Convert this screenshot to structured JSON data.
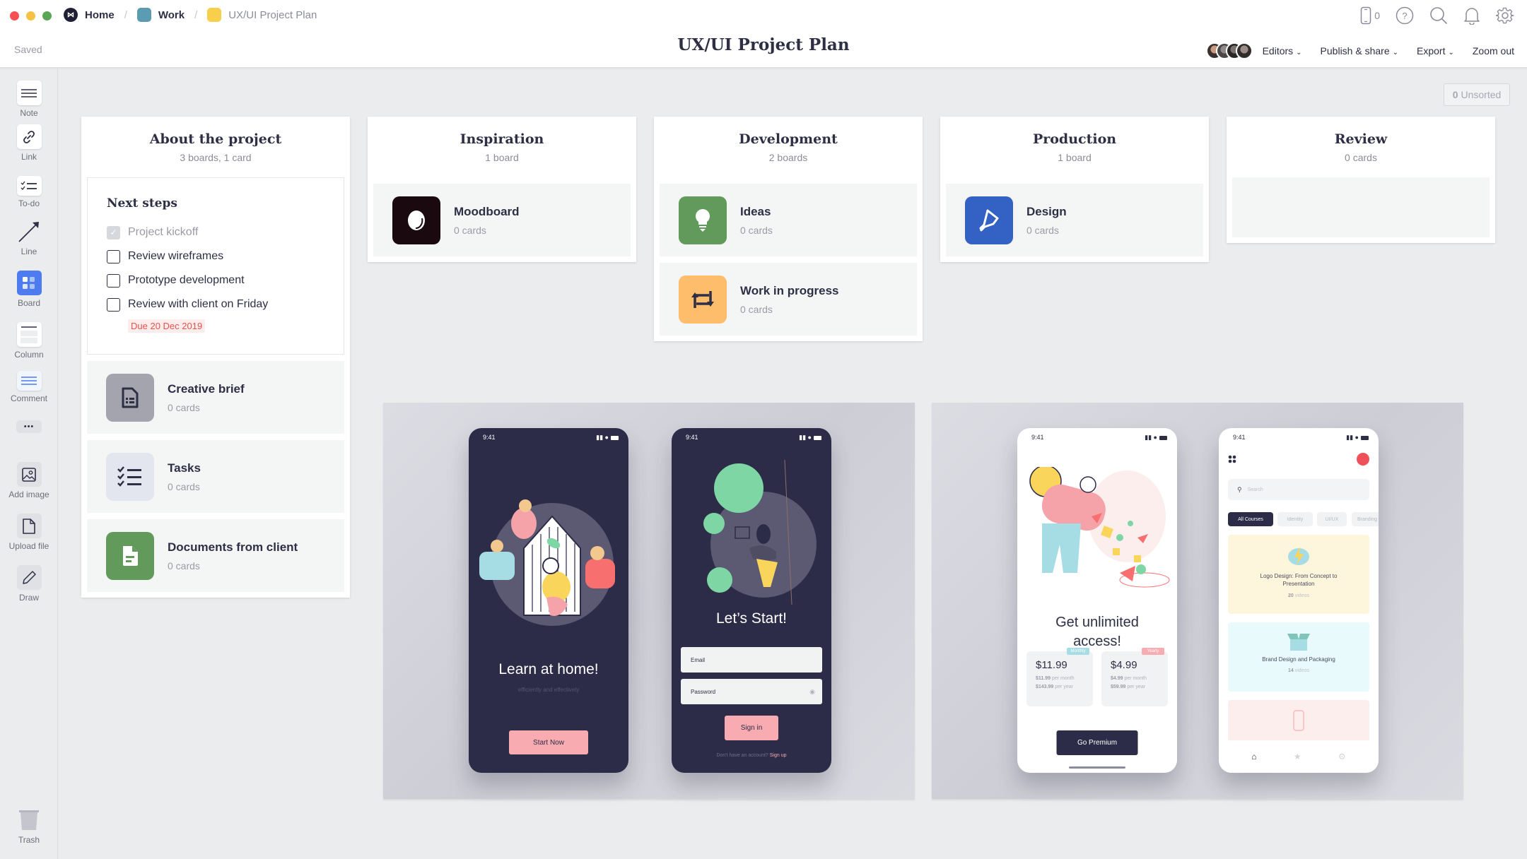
{
  "window": {
    "traffic_lights": [
      "#f65055",
      "#f6c245",
      "#5aa556"
    ]
  },
  "breadcrumb": {
    "items": [
      {
        "label": "Home",
        "icon": "milanote-logo-icon",
        "color": "#1f2033"
      },
      {
        "label": "Work",
        "icon": "board-color-icon",
        "color": "#5b9cb3"
      },
      {
        "label": "UX/UI Project Plan",
        "icon": "board-color-icon",
        "color": "#f7cf4a"
      }
    ]
  },
  "header": {
    "saved_status": "Saved",
    "title": "UX/UI Project Plan",
    "mobile_count": "0",
    "menu": {
      "editors": "Editors",
      "publish": "Publish & share",
      "export": "Export",
      "zoom": "Zoom out"
    },
    "editor_avatars": 4
  },
  "sidebar": {
    "tools": [
      {
        "label": "Note",
        "icon": "note-icon"
      },
      {
        "label": "Link",
        "icon": "link-icon"
      },
      {
        "label": "To-do",
        "icon": "todo-icon"
      },
      {
        "label": "Line",
        "icon": "line-arrow-icon"
      },
      {
        "label": "Board",
        "icon": "board-icon"
      },
      {
        "label": "Column",
        "icon": "column-icon"
      },
      {
        "label": "Comment",
        "icon": "comment-icon"
      },
      {
        "label": "Add image",
        "icon": "image-icon"
      },
      {
        "label": "Upload file",
        "icon": "file-icon"
      },
      {
        "label": "Draw",
        "icon": "pencil-icon"
      },
      {
        "label": "Trash",
        "icon": "trash-icon"
      }
    ],
    "more": "•••"
  },
  "unsorted": {
    "count": "0",
    "label": "Unsorted"
  },
  "columns": [
    {
      "title": "About the project",
      "subtitle": "3 boards, 1 card",
      "todo": {
        "title": "Next steps",
        "items": [
          {
            "text": "Project kickoff",
            "done": true
          },
          {
            "text": "Review wireframes",
            "done": false
          },
          {
            "text": "Prototype development",
            "done": false
          },
          {
            "text": "Review with client on Friday",
            "done": false
          }
        ],
        "due": "Due 20 Dec 2019"
      },
      "boards": [
        {
          "name": "Creative brief",
          "sub": "0 cards",
          "color": "#a3a4ad"
        },
        {
          "name": "Tasks",
          "sub": "0 cards",
          "color": "#e4e6ef"
        },
        {
          "name": "Documents from client",
          "sub": "0 cards",
          "color": "#629a5b"
        }
      ]
    },
    {
      "title": "Inspiration",
      "subtitle": "1 board",
      "boards": [
        {
          "name": "Moodboard",
          "sub": "0 cards",
          "color": "#1a0a10"
        }
      ]
    },
    {
      "title": "Development",
      "subtitle": "2 boards",
      "boards": [
        {
          "name": "Ideas",
          "sub": "0 cards",
          "color": "#629a5b"
        },
        {
          "name": "Work in progress",
          "sub": "0 cards",
          "color": "#fdbd6a"
        }
      ]
    },
    {
      "title": "Production",
      "subtitle": "1 board",
      "boards": [
        {
          "name": "Design",
          "sub": "0 cards",
          "color": "#3362c4"
        }
      ]
    },
    {
      "title": "Review",
      "subtitle": "0 cards",
      "boards": []
    }
  ],
  "mockups": {
    "phone1": {
      "time": "9:41",
      "headline": "Learn at home!",
      "sub": "efficiently and effectively",
      "button": "Start Now"
    },
    "phone2": {
      "time": "9:41",
      "headline": "Let’s Start!",
      "email_placeholder": "Email",
      "password_placeholder": "Password",
      "button": "Sign in",
      "footer": "Don't have an account?",
      "footer_link": "Sign up"
    },
    "phone3": {
      "time": "9:41",
      "headline_1": "Get unlimited",
      "headline_2": "access!",
      "plans": [
        {
          "tag": "Monthly",
          "price": "$11.99",
          "per_month": "$11.99",
          "per_month_label": "per month",
          "per_year": "$143.99",
          "per_year_label": "per year"
        },
        {
          "tag": "Yearly",
          "price": "$4.99",
          "per_month": "$4.99",
          "per_month_label": "per month",
          "per_year": "$59.99",
          "per_year_label": "per year"
        }
      ],
      "button": "Go Premium"
    },
    "phone4": {
      "time": "9:41",
      "search_placeholder": "Search",
      "chips": [
        "All Courses",
        "Identity",
        "UI/UX",
        "Branding"
      ],
      "courses": [
        {
          "title_1": "Logo Design: From Concept to",
          "title_2": "Presentation",
          "count": "20",
          "count_label": "videos"
        },
        {
          "title_1": "Brand Design and Packaging",
          "title_2": "",
          "count": "14",
          "count_label": "videos"
        }
      ]
    }
  }
}
